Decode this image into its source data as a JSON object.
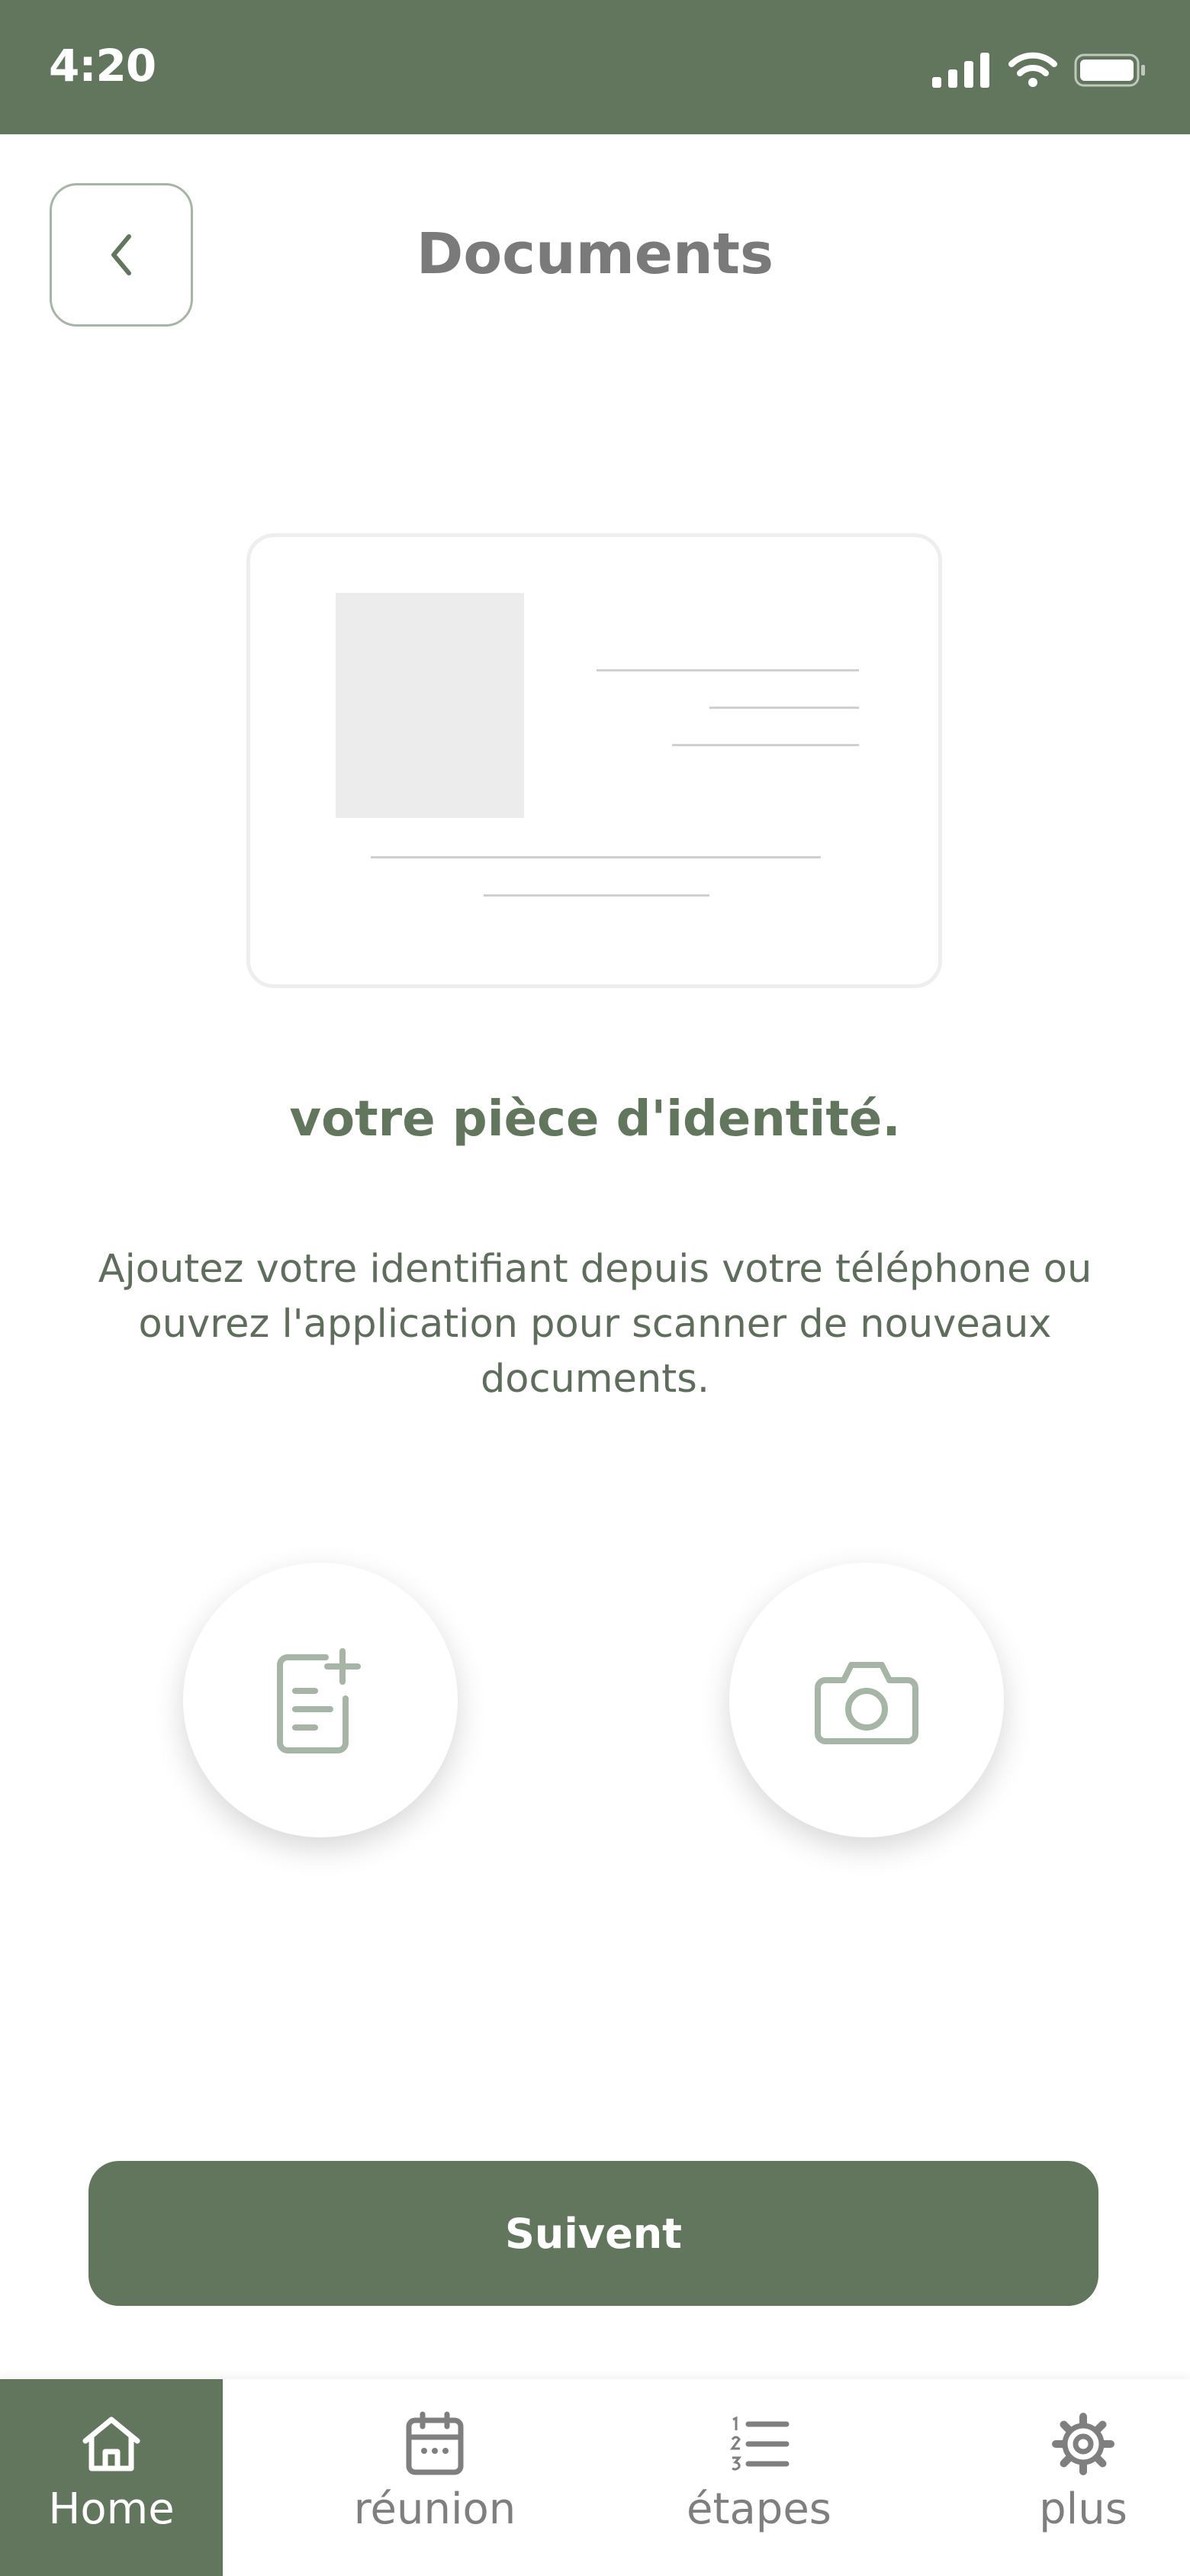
{
  "status_bar": {
    "time": "4:20"
  },
  "header": {
    "title": "Documents"
  },
  "headline": "votre pièce d'identité.",
  "description": "Ajoutez votre identifiant depuis votre téléphone ou ouvrez l'application pour scanner de nouveaux documents.",
  "next_button": {
    "label": "Suivent"
  },
  "tabs": [
    {
      "label": "Home",
      "icon": "home-icon",
      "active": true
    },
    {
      "label": "réunion",
      "icon": "calendar-icon",
      "active": false
    },
    {
      "label": "étapes",
      "icon": "numbered-list-icon",
      "active": false
    },
    {
      "label": "plus",
      "icon": "gear-icon",
      "active": false
    }
  ],
  "colors": {
    "primary": "#61765D",
    "muted_text": "#7a7a7a",
    "icon_muted": "#a7b5a6"
  }
}
